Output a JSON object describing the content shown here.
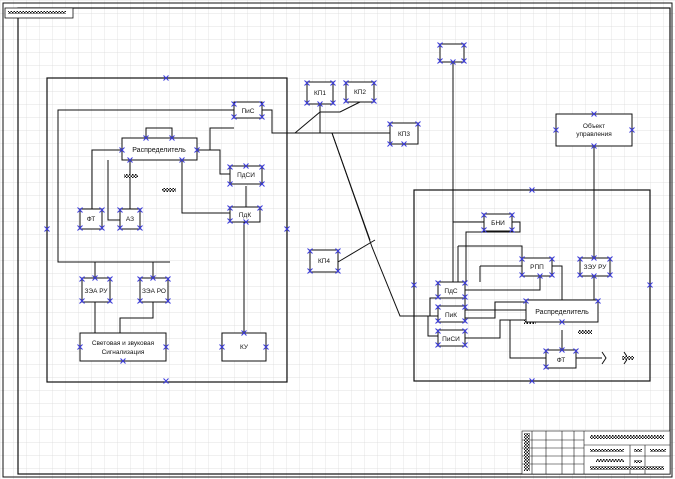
{
  "diagram": {
    "blocks": {
      "pis_left": "ПиС",
      "raspredelitel_left": "Распределитель",
      "pdsi_left": "ПдСИ",
      "pdk_left": "ПдК",
      "ft_left": "ФТ",
      "az": "АЗ",
      "zea_ru": "ЗЭА РУ",
      "zea_ro": "ЗЭА РО",
      "signal_line1": "Световая и звуковая",
      "signal_line2": "Сигнализация",
      "ku": "КУ",
      "kp1": "КП1",
      "kp2": "КП2",
      "kp3": "КП3",
      "kp4": "КП4",
      "object_line1": "Объект",
      "object_line2": "управления",
      "bni": "БНИ",
      "rpp": "РПП",
      "zeu_ru": "ЗЭУ РУ",
      "pds_right": "ПдС",
      "pik_right": "ПиК",
      "pisi_right": "ПиСИ",
      "raspredelitel_right": "Распределитель",
      "ft_right": "ФТ"
    },
    "colors": {
      "grid": "#d9d9d9",
      "line": "#1a1a1a",
      "marker": "#3a3adf"
    }
  }
}
